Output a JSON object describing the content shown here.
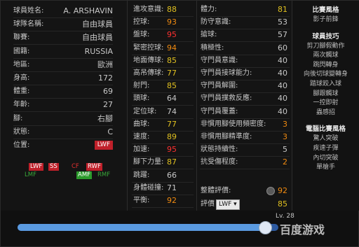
{
  "profile": {
    "name_label": "球員姓名:",
    "name_value": "A. ARSHAVIN",
    "club_label": "球隊名稱:",
    "club_value": "自由球員",
    "contract_label": "聯賽:",
    "contract_value": "自由球員",
    "nation_label": "國籍:",
    "nation_value": "RUSSIA",
    "region_label": "地區:",
    "region_value": "歐洲",
    "height_label": "身高:",
    "height_value": "172",
    "weight_label": "體重:",
    "weight_value": "69",
    "age_label": "年齡:",
    "age_value": "27",
    "foot_label": "腳:",
    "foot_value": "右腳",
    "condition_label": "狀態:",
    "condition_value": "C",
    "position_label": "位置:",
    "position_value": "LWF"
  },
  "positions": [
    {
      "label": "LWF",
      "style": "red"
    },
    {
      "label": "SS",
      "style": "red"
    },
    {
      "label": "CF",
      "style": "redtext"
    },
    {
      "label": "RWF",
      "style": "red"
    },
    {
      "label": "LMF",
      "style": "greentext"
    },
    {
      "label": "AMF",
      "style": "green"
    },
    {
      "label": "RMF",
      "style": "greentext"
    }
  ],
  "stats_a": [
    {
      "label": "進攻意識:",
      "value": "88",
      "color": "#e0c020"
    },
    {
      "label": "控球:",
      "value": "93",
      "color": "#f08a10"
    },
    {
      "label": "盤球:",
      "value": "95",
      "color": "#ff3030"
    },
    {
      "label": "緊密控球:",
      "value": "94",
      "color": "#f08a10"
    },
    {
      "label": "地面傳球:",
      "value": "85",
      "color": "#e0c020"
    },
    {
      "label": "高吊傳球:",
      "value": "77",
      "color": "#e0c020"
    },
    {
      "label": "射門:",
      "value": "85",
      "color": "#e0c020"
    },
    {
      "label": "頭球:",
      "value": "64",
      "color": "#c8c8c8"
    },
    {
      "label": "定位球:",
      "value": "74",
      "color": "#c8c8c8"
    },
    {
      "label": "曲球:",
      "value": "77",
      "color": "#e0c020"
    },
    {
      "label": "速度:",
      "value": "89",
      "color": "#e0c020"
    },
    {
      "label": "加速:",
      "value": "95",
      "color": "#ff3030"
    },
    {
      "label": "腳下力量:",
      "value": "87",
      "color": "#e0c020"
    },
    {
      "label": "跳躍:",
      "value": "66",
      "color": "#c8c8c8"
    },
    {
      "label": "身體碰撞:",
      "value": "71",
      "color": "#c8c8c8"
    },
    {
      "label": "平衡:",
      "value": "92",
      "color": "#f08a10"
    }
  ],
  "stats_b": [
    {
      "label": "體力:",
      "value": "81",
      "color": "#e0c020"
    },
    {
      "label": "防守意識:",
      "value": "53",
      "color": "#c8c8c8"
    },
    {
      "label": "搶球:",
      "value": "57",
      "color": "#c8c8c8"
    },
    {
      "label": "積極性:",
      "value": "60",
      "color": "#c8c8c8"
    },
    {
      "label": "守門員意識:",
      "value": "40",
      "color": "#c8c8c8"
    },
    {
      "label": "守門員接球能力:",
      "value": "40",
      "color": "#c8c8c8"
    },
    {
      "label": "守門員解圍:",
      "value": "40",
      "color": "#c8c8c8"
    },
    {
      "label": "守門員撲救反應:",
      "value": "40",
      "color": "#c8c8c8"
    },
    {
      "label": "守門員覆蓋:",
      "value": "40",
      "color": "#c8c8c8"
    },
    {
      "label": "非慣用腳使用頻密度:",
      "value": "3",
      "color": "#f08a10"
    },
    {
      "label": "非慣用腳精準度:",
      "value": "3",
      "color": "#f08a10"
    },
    {
      "label": "狀態持續性:",
      "value": "5",
      "color": "#c8c8c8"
    },
    {
      "label": "抗受傷程度:",
      "value": "2",
      "color": "#f08a10"
    }
  ],
  "overall": {
    "label": "整體評價:",
    "value": "92",
    "color": "#f08a10"
  },
  "rating": {
    "label": "評價",
    "select_value": "LWF",
    "value": "85",
    "color": "#e0c020"
  },
  "level": {
    "text": "Lv. 28",
    "fraction": 0.95
  },
  "styles": {
    "title1": "比賽風格",
    "items1": [
      "影子前鋒"
    ],
    "title2": "球員技巧",
    "items2": [
      "剪刀腳假動作",
      "兩次觸球",
      "跳閃轉身",
      "向後切球變轉身",
      "踏球跤入球",
      "腳跟觸球",
      "一控即射",
      "蟲感招"
    ],
    "title3": "電腦比賽風格",
    "items3": [
      "驚人突破",
      "疾速子彈",
      "內切突破",
      "單槍手"
    ]
  },
  "watermark": "百度游戏"
}
